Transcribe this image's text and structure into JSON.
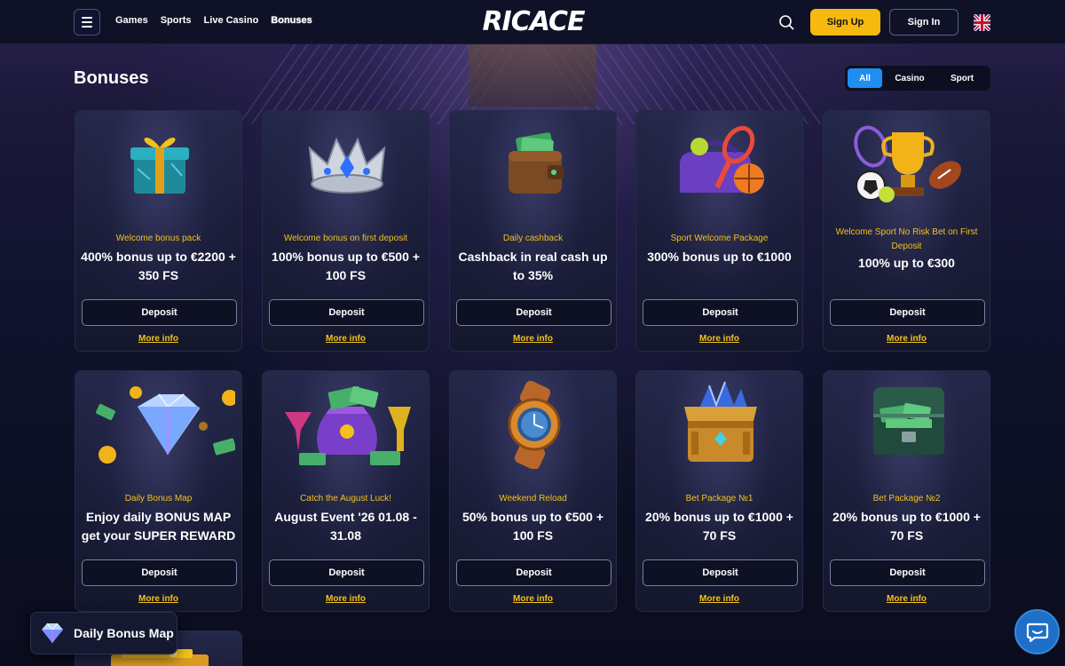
{
  "header": {
    "logo_text": "RICACE",
    "nav": [
      {
        "label": "Games"
      },
      {
        "label": "Sports"
      },
      {
        "label": "Live Casino"
      },
      {
        "label": "Bonuses",
        "active": true
      }
    ],
    "signup_label": "Sign Up",
    "signin_label": "Sign In",
    "accent_color": "#f6b90f",
    "language_icon": "uk-flag-icon"
  },
  "page": {
    "title": "Bonuses",
    "filters": [
      {
        "label": "All",
        "active": true
      },
      {
        "label": "Casino"
      },
      {
        "label": "Sport"
      }
    ],
    "filter_active_color": "#1f8ef1"
  },
  "cards": [
    {
      "icon": "gift-box-icon",
      "label": "Welcome bonus pack",
      "title": "400% bonus up to €2200 + 350 FS",
      "button": "Deposit",
      "link": "More info"
    },
    {
      "icon": "crown-icon",
      "label": "Welcome bonus on first deposit",
      "title": "100% bonus up to €500 + 100 FS",
      "button": "Deposit",
      "link": "More info"
    },
    {
      "icon": "wallet-icon",
      "label": "Daily cashback",
      "title": "Cashback in real cash up to 35%",
      "button": "Deposit",
      "link": "More info"
    },
    {
      "icon": "sport-bag-icon",
      "label": "Sport Welcome Package",
      "title": "300% bonus up to €1000",
      "button": "Deposit",
      "link": "More info"
    },
    {
      "icon": "trophy-icon",
      "label": "Welcome Sport No Risk Bet on First Deposit",
      "title": "100% up to €300",
      "button": "Deposit",
      "link": "More info"
    },
    {
      "icon": "diamond-icon",
      "label": "Daily Bonus Map",
      "title": "Enjoy daily BONUS MAP get your SUPER REWARD",
      "button": "Deposit",
      "link": "More info"
    },
    {
      "icon": "money-bag-cocktail-icon",
      "label": "Catch the August Luck!",
      "title": "August Event '26 01.08 - 31.08",
      "button": "Deposit",
      "link": "More info"
    },
    {
      "icon": "watch-icon",
      "label": "Weekend Reload",
      "title": "50% bonus up to €500 + 100 FS",
      "button": "Deposit",
      "link": "More info"
    },
    {
      "icon": "treasure-chest-gems-icon",
      "label": "Bet Package №1",
      "title": "20% bonus up to €1000 + 70 FS",
      "button": "Deposit",
      "link": "More info"
    },
    {
      "icon": "money-chest-icon",
      "label": "Bet Package №2",
      "title": "20% bonus up to €1000 + 70 FS",
      "button": "Deposit",
      "link": "More info"
    }
  ],
  "daily_widget": {
    "label": "Daily Bonus Map",
    "icon": "diamond-icon"
  },
  "chat": {
    "icon": "chat-icon"
  }
}
